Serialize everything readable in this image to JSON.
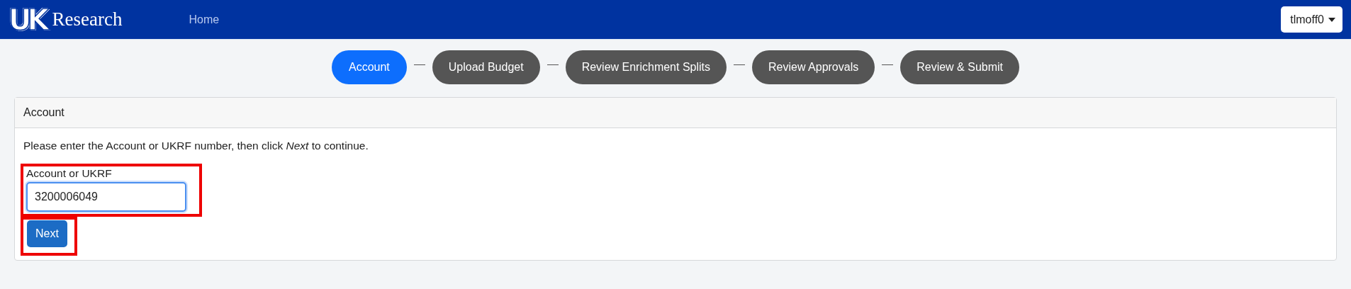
{
  "navbar": {
    "logo_mark": "UK",
    "brand": "Research",
    "links": [
      {
        "label": "Home"
      }
    ],
    "user_menu": {
      "label": "tlmoff0"
    }
  },
  "steps": [
    {
      "label": "Account",
      "selected": true
    },
    {
      "label": "Upload Budget",
      "selected": false
    },
    {
      "label": "Review Enrichment Splits",
      "selected": false
    },
    {
      "label": "Review Approvals",
      "selected": false
    },
    {
      "label": "Review & Submit",
      "selected": false
    }
  ],
  "card": {
    "title": "Account",
    "instructions": "Please enter the Account or UKRF number, then click *Next* to continue.",
    "field": {
      "label": "Account or UKRF",
      "value": "3200006049",
      "focused": true,
      "highlighted": true
    },
    "button": {
      "label": "Next",
      "highlighted": true
    }
  }
}
